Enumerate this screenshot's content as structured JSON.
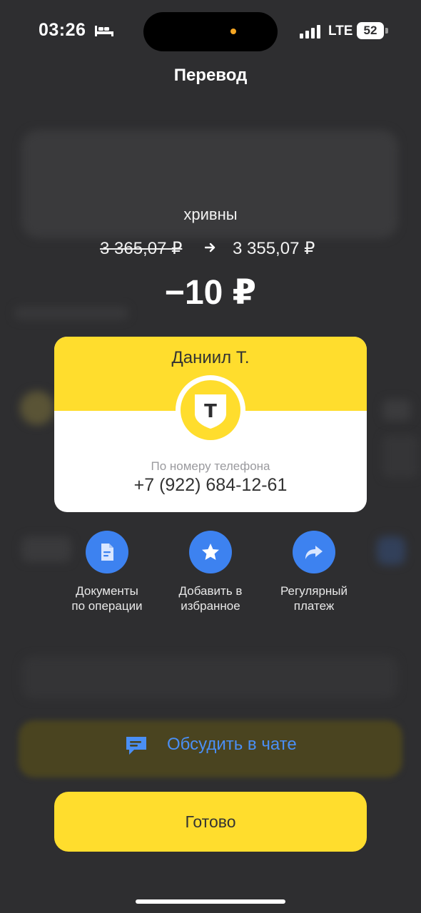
{
  "status_bar": {
    "time": "03:26",
    "network": "LTE",
    "battery": "52"
  },
  "header": {
    "title": "Перевод"
  },
  "transfer": {
    "currency_note": "хривны",
    "balance_before": "3 365,07 ₽",
    "balance_after": "3 355,07 ₽",
    "amount": "−10 ₽"
  },
  "recipient": {
    "name": "Даниил Т.",
    "method": "По номеру телефона",
    "phone": "+7 (922) 684-12-61",
    "bank_logo_letter": "T"
  },
  "actions": [
    {
      "label": "Документы\nпо операции",
      "icon": "document-icon"
    },
    {
      "label": "Добавить в\nизбранное",
      "icon": "star-icon"
    },
    {
      "label": "Регулярный\nплатеж",
      "icon": "forward-arrow-icon"
    }
  ],
  "chat": {
    "label": "Обсудить в чате",
    "icon": "chat-icon"
  },
  "done_button": {
    "label": "Готово"
  },
  "colors": {
    "background": "#2e2e30",
    "brand_yellow": "#ffdd2d",
    "accent_blue": "#3d82f0",
    "chat_text_blue": "#4a8ff5"
  }
}
